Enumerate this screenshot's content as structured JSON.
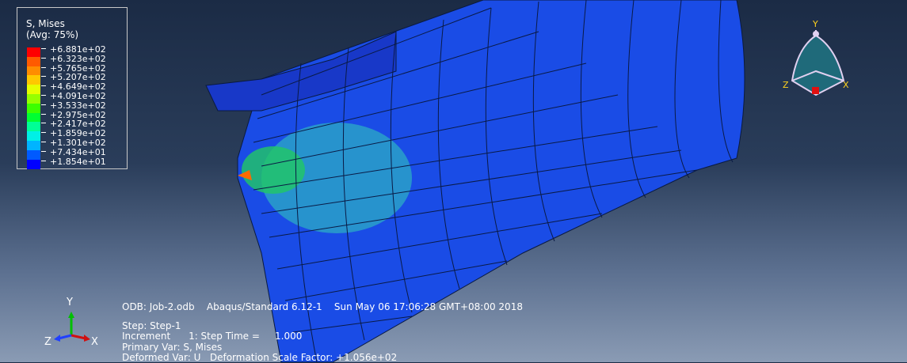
{
  "legend": {
    "title": "S, Mises",
    "subtitle": "(Avg: 75%)",
    "entries": [
      {
        "value": "+6.881e+02",
        "color": "#ff0000"
      },
      {
        "value": "+6.323e+02",
        "color": "#ff5a00"
      },
      {
        "value": "+5.765e+02",
        "color": "#ff8c00"
      },
      {
        "value": "+5.207e+02",
        "color": "#ffc800"
      },
      {
        "value": "+4.649e+02",
        "color": "#e6ff00"
      },
      {
        "value": "+4.091e+02",
        "color": "#96ff00"
      },
      {
        "value": "+3.533e+02",
        "color": "#3cff00"
      },
      {
        "value": "+2.975e+02",
        "color": "#00ff32"
      },
      {
        "value": "+2.417e+02",
        "color": "#00ff96"
      },
      {
        "value": "+1.859e+02",
        "color": "#00f0e6"
      },
      {
        "value": "+1.301e+02",
        "color": "#00b4ff"
      },
      {
        "value": "+7.434e+01",
        "color": "#005aff"
      },
      {
        "value": "+1.854e+01",
        "color": "#0000ff"
      }
    ]
  },
  "info": {
    "line1": "ODB: Job-2.odb    Abaqus/Standard 6.12-1    Sun May 06 17:06:28 GMT+08:00 2018",
    "line2": "Step: Step-1",
    "line3": "Increment      1: Step Time =     1.000",
    "line4": "Primary Var: S, Mises",
    "line5": "Deformed Var: U   Deformation Scale Factor: +1.056e+02"
  },
  "triad": {
    "x": "X",
    "y": "Y",
    "z": "Z"
  },
  "compass": {
    "x": "X",
    "y": "Y",
    "z": "Z"
  }
}
